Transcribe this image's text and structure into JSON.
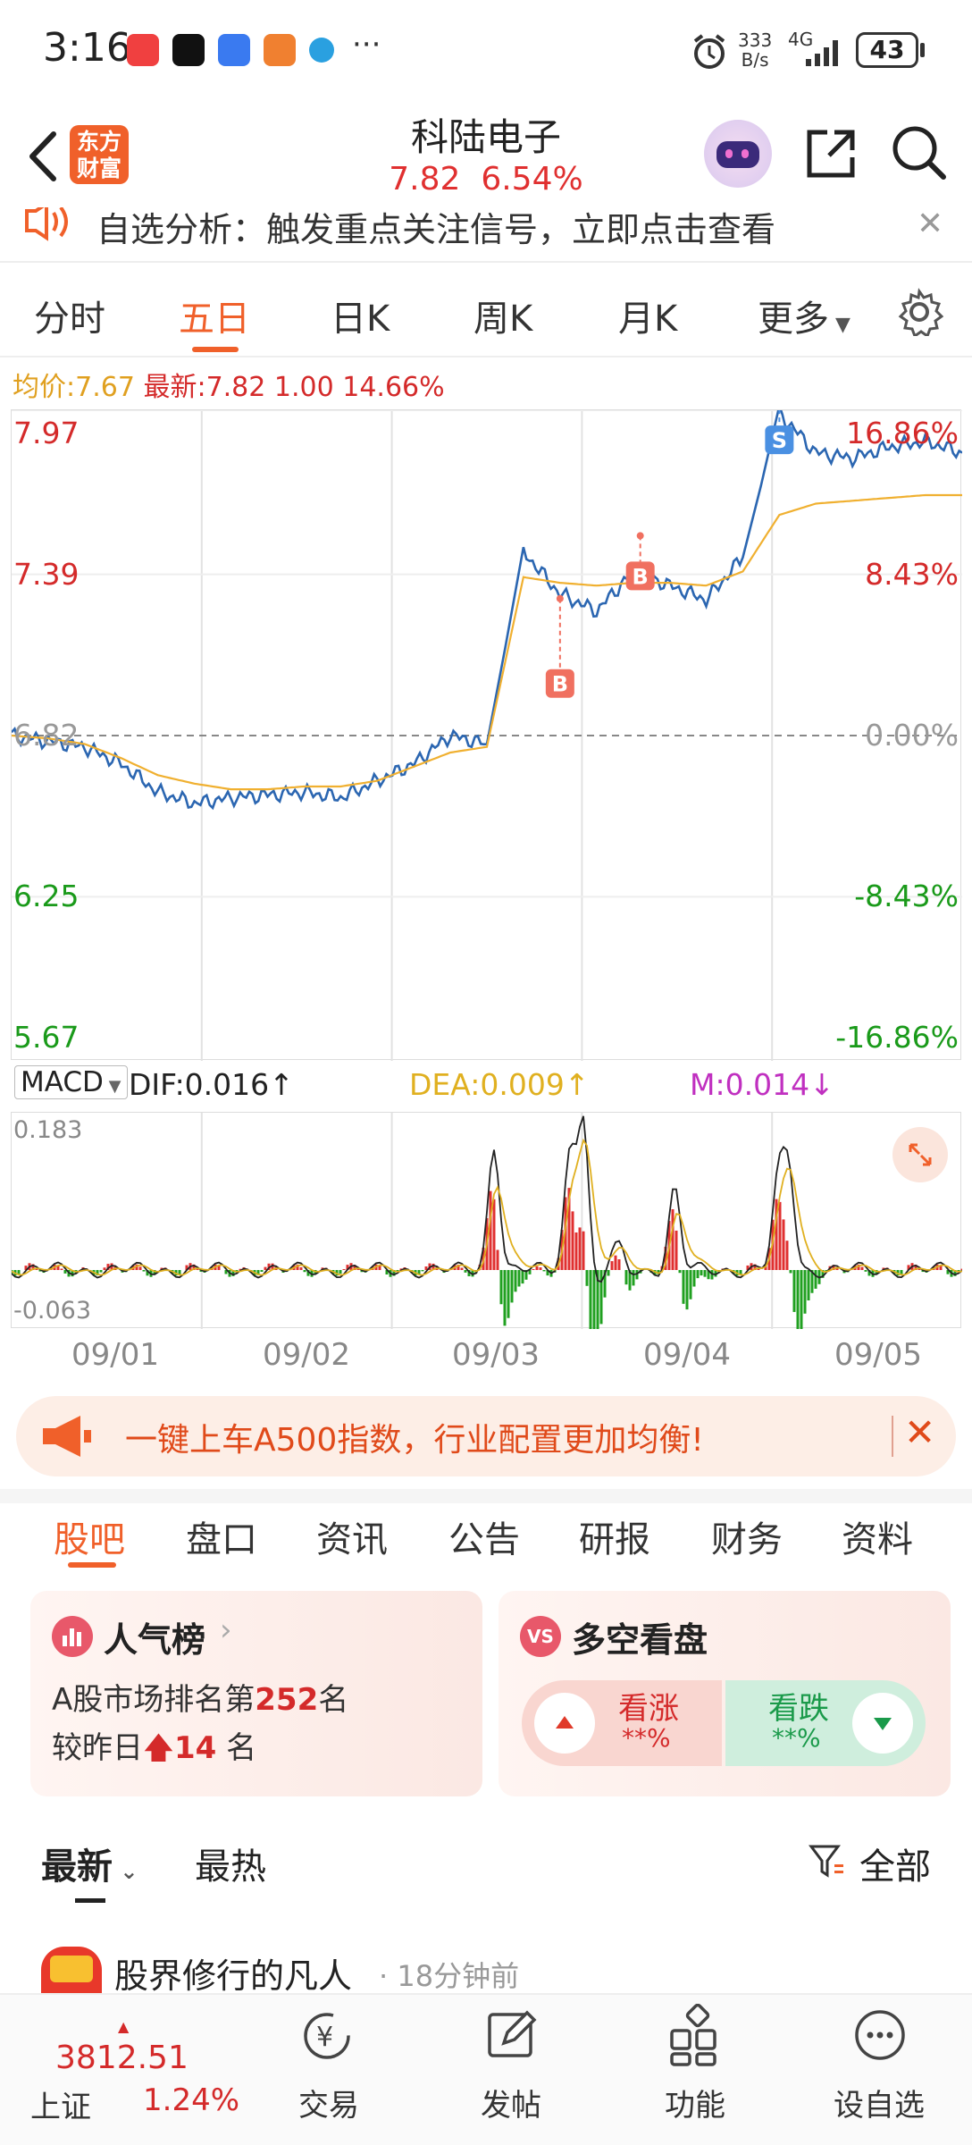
{
  "status_bar": {
    "time": "3:16",
    "net_speed_top": "333",
    "net_speed_bottom": "B/s",
    "network": "4G",
    "battery": "43",
    "more": "···"
  },
  "header": {
    "logo_line1": "东方",
    "logo_line2": "财富",
    "title": "科陆电子",
    "price": "7.82",
    "change_pct": "6.54%"
  },
  "notice": {
    "text": "自选分析：触发重点关注信号，立即点击查看",
    "close": "✕"
  },
  "chart_tabs": [
    "分时",
    "五日",
    "日K",
    "周K",
    "月K",
    "更多"
  ],
  "active_tab_index": 1,
  "price_info": {
    "avg_label": "均价:",
    "avg_value": "7.67",
    "latest_label": "最新:",
    "latest_value": "7.82",
    "change_value": "1.00",
    "change_pct": "14.66%"
  },
  "chart_data": {
    "type": "line",
    "x": [
      "09/01",
      "09/02",
      "09/03",
      "09/04",
      "09/05"
    ],
    "y_left_ticks": [
      "7.97",
      "7.39",
      "6.82",
      "6.25",
      "5.67"
    ],
    "y_right_ticks": [
      "16.86%",
      "8.43%",
      "0.00%",
      "-8.43%",
      "-16.86%"
    ],
    "ylim": [
      5.67,
      7.97
    ],
    "prev_close": 6.82,
    "series": [
      {
        "values": [
          6.82,
          6.8,
          6.78,
          6.72,
          6.62,
          6.58,
          6.6,
          6.61,
          6.62,
          6.6,
          6.66,
          6.72,
          6.82,
          6.79,
          7.47,
          7.32,
          7.26,
          7.4,
          7.35,
          7.3,
          7.45,
          7.96,
          7.82,
          7.8,
          7.84,
          7.86,
          7.82
        ]
      },
      {
        "values": [
          6.82,
          6.81,
          6.79,
          6.74,
          6.68,
          6.65,
          6.63,
          6.63,
          6.64,
          6.64,
          6.66,
          6.71,
          6.76,
          6.78,
          7.38,
          7.36,
          7.35,
          7.36,
          7.36,
          7.35,
          7.4,
          7.6,
          7.64,
          7.65,
          7.66,
          7.67,
          7.67
        ]
      }
    ],
    "markers": [
      "B",
      "B",
      "S"
    ]
  },
  "macd": {
    "name": "MACD",
    "dif": "DIF:0.016↑",
    "dea": "DEA:0.009↑",
    "m": "M:0.014↓",
    "ymax": "0.183",
    "ymin": "-0.063"
  },
  "ad": {
    "text": "一键上车A500指数，行业配置更加均衡!",
    "close": "✕"
  },
  "bottom_tabs": [
    "股吧",
    "盘口",
    "资讯",
    "公告",
    "研报",
    "财务",
    "资料"
  ],
  "popularity": {
    "title": "人气榜",
    "rank_prefix": "A股市场排名第",
    "rank": "252",
    "rank_suffix": "名",
    "change_prefix": "较昨日",
    "change": "14",
    "change_suffix": "名"
  },
  "sentiment": {
    "title": "多空看盘",
    "up_label": "看涨",
    "up_value": "**%",
    "down_label": "看跌",
    "down_value": "**%"
  },
  "sort_tabs": {
    "latest": "最新",
    "hot": "最热",
    "filter": "全部"
  },
  "post": {
    "author": "股界修行的凡人",
    "time": "18分钟前"
  },
  "nav": {
    "index_value": "3812.51",
    "index_name": "上证",
    "index_change": "1.24%",
    "items": [
      "交易",
      "发帖",
      "功能",
      "设自选"
    ]
  },
  "colors": {
    "accent": "#f0602a",
    "up": "#d42a2a",
    "down": "#1a9a1a",
    "line": "#2b66b1",
    "avg": "#f0b030"
  }
}
